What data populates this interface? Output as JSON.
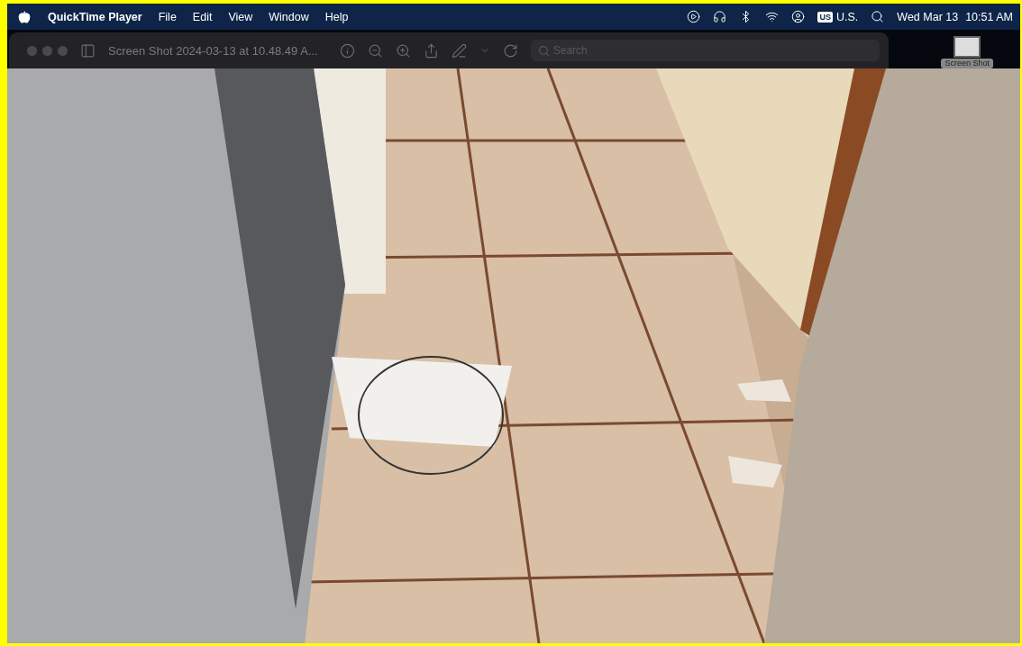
{
  "menu_bar": {
    "app_name": "QuickTime Player",
    "menus": [
      "File",
      "Edit",
      "View",
      "Window",
      "Help"
    ],
    "input_source": {
      "badge": "US",
      "label": "U.S."
    },
    "date": "Wed Mar 13",
    "time": "10:51 AM"
  },
  "window": {
    "title": "Screen Shot 2024-03-13 at 10.48.49 A...",
    "search": {
      "placeholder": "Search"
    }
  },
  "desktop_icon": {
    "label": "Screen Shot"
  }
}
